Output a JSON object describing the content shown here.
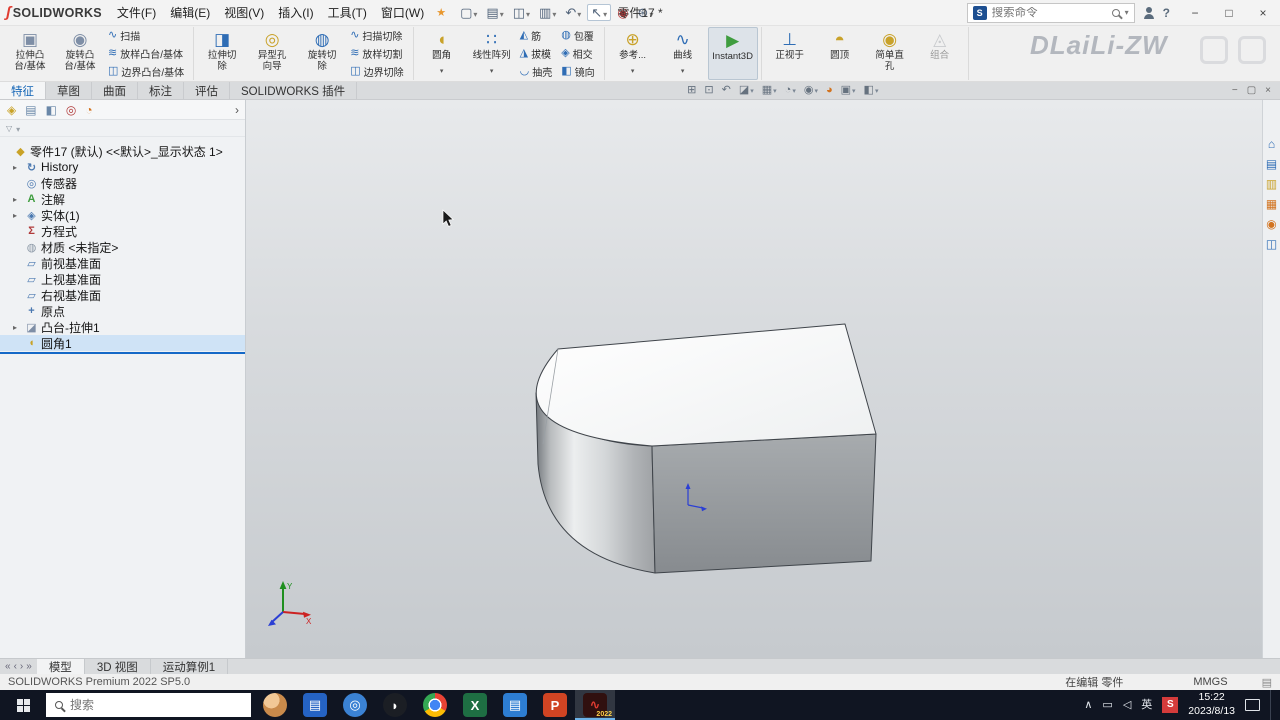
{
  "title_bar": {
    "logo_text": "SOLIDWORKS",
    "logo_mark": "ʃ",
    "menus": [
      "文件(F)",
      "编辑(E)",
      "视图(V)",
      "插入(I)",
      "工具(T)",
      "窗口(W)"
    ],
    "menu_star": "★",
    "document_title": "零件17 *",
    "qat": [
      {
        "name": "new-document-button",
        "glyph": "▢",
        "caret": true
      },
      {
        "name": "open-button",
        "glyph": "▤",
        "caret": true
      },
      {
        "name": "save-button",
        "glyph": "◫",
        "caret": true
      },
      {
        "name": "print-button",
        "glyph": "▥",
        "caret": true
      },
      {
        "name": "undo-button",
        "glyph": "↶",
        "caret": true
      },
      {
        "name": "select-button",
        "glyph": "↖",
        "caret": true,
        "active": true
      },
      {
        "name": "rebuild-button",
        "glyph": "◉",
        "color": "#c43b3b"
      },
      {
        "name": "options-button",
        "glyph": "⊛",
        "caret": true
      }
    ],
    "search": {
      "placeholder": "搜索命令",
      "scope_initial": "S"
    },
    "window_controls": [
      {
        "name": "minimize-button",
        "glyph": "−"
      },
      {
        "name": "maximize-button",
        "glyph": "□"
      },
      {
        "name": "close-button",
        "glyph": "×"
      }
    ]
  },
  "ribbon": {
    "watermark": "DLaiLi-ZW",
    "groups": [
      {
        "cells": [
          {
            "items": [
              {
                "big": true,
                "name": "extruded-boss-button",
                "glyph": "▣",
                "color": "#7e8ea6",
                "label": "拉伸凸\n台/基体"
              }
            ]
          },
          {
            "items": [
              {
                "big": true,
                "name": "revolved-boss-button",
                "glyph": "◉",
                "color": "#7e8ea6",
                "label": "旋转凸\n台/基体"
              }
            ]
          },
          {
            "items": [
              {
                "name": "swept-boss-button",
                "glyph": "∿",
                "color": "#2f6db5",
                "label": "扫描"
              },
              {
                "name": "lofted-boss-button",
                "glyph": "≋",
                "color": "#2f6db5",
                "label": "放样凸台/基体"
              },
              {
                "name": "boundary-boss-button",
                "glyph": "◫",
                "color": "#2f6db5",
                "label": "边界凸台/基体"
              }
            ]
          }
        ]
      },
      {
        "cells": [
          {
            "items": [
              {
                "big": true,
                "name": "extruded-cut-button",
                "glyph": "◨",
                "color": "#2f6db5",
                "label": "拉伸切\n除"
              }
            ]
          },
          {
            "items": [
              {
                "big": true,
                "name": "hole-wizard-button",
                "glyph": "◎",
                "color": "#c9a22a",
                "label": "异型孔\n向导"
              }
            ]
          },
          {
            "items": [
              {
                "big": true,
                "name": "revolved-cut-button",
                "glyph": "◍",
                "color": "#2f6db5",
                "label": "旋转切\n除"
              }
            ]
          },
          {
            "items": [
              {
                "name": "swept-cut-button",
                "glyph": "∿",
                "color": "#2f6db5",
                "label": "扫描切除"
              },
              {
                "name": "lofted-cut-button",
                "glyph": "≋",
                "color": "#2f6db5",
                "label": "放样切割"
              },
              {
                "name": "boundary-cut-button",
                "glyph": "◫",
                "color": "#2f6db5",
                "label": "边界切除"
              }
            ]
          }
        ]
      },
      {
        "cells": [
          {
            "items": [
              {
                "big": true,
                "name": "fillet-button",
                "glyph": "◖",
                "color": "#c9a22a",
                "label": "圆角",
                "caret": true
              }
            ]
          },
          {
            "items": [
              {
                "big": true,
                "name": "linear-pattern-button",
                "glyph": "∷",
                "color": "#2f6db5",
                "label": "线性阵列",
                "caret": true
              }
            ]
          },
          {
            "items": [
              {
                "name": "rib-button",
                "glyph": "◭",
                "color": "#2f6db5",
                "label": "筋"
              },
              {
                "name": "draft-button",
                "glyph": "◮",
                "color": "#2f6db5",
                "label": "拔模"
              },
              {
                "name": "shell-button",
                "glyph": "◡",
                "color": "#2f6db5",
                "label": "抽壳"
              }
            ]
          },
          {
            "items": [
              {
                "name": "wrap-button",
                "glyph": "◍",
                "color": "#2f6db5",
                "label": "包覆"
              },
              {
                "name": "intersect-button",
                "glyph": "◈",
                "color": "#2f6db5",
                "label": "相交"
              },
              {
                "name": "mirror-button",
                "glyph": "◧",
                "color": "#2f6db5",
                "label": "镜向"
              }
            ]
          }
        ]
      },
      {
        "cells": [
          {
            "items": [
              {
                "big": true,
                "name": "reference-geometry-button",
                "glyph": "⊕",
                "color": "#c9a22a",
                "label": "参考...",
                "caret": true
              }
            ]
          },
          {
            "items": [
              {
                "big": true,
                "name": "curves-button",
                "glyph": "∿",
                "color": "#2f6db5",
                "label": "曲线",
                "caret": true
              }
            ]
          },
          {
            "items": [
              {
                "big": true,
                "name": "instant3d-button",
                "glyph": "▶",
                "color": "#3f9d3f",
                "label": "Instant3D",
                "active": true
              }
            ]
          }
        ]
      },
      {
        "cells": [
          {
            "items": [
              {
                "big": true,
                "name": "normal-to-button",
                "glyph": "⊥",
                "color": "#2f6db5",
                "label": "正视于"
              }
            ]
          },
          {
            "items": [
              {
                "big": true,
                "name": "dome-button",
                "glyph": "◓",
                "color": "#c9a22a",
                "label": "圆顶"
              }
            ]
          },
          {
            "items": [
              {
                "big": true,
                "name": "simple-hole-button",
                "glyph": "◉",
                "color": "#c9a22a",
                "label": "简单直\n孔"
              }
            ]
          },
          {
            "items": [
              {
                "big": true,
                "name": "combine-button",
                "glyph": "◬",
                "color": "#9aa0a6",
                "label": "组合",
                "disabled": true
              }
            ]
          }
        ]
      }
    ]
  },
  "command_tabs": [
    {
      "name": "tab-features",
      "label": "特征",
      "active": true
    },
    {
      "name": "tab-sketch",
      "label": "草图"
    },
    {
      "name": "tab-surfaces",
      "label": "曲面"
    },
    {
      "name": "tab-markup",
      "label": "标注"
    },
    {
      "name": "tab-evaluate",
      "label": "评估"
    },
    {
      "name": "tab-addins",
      "label": "SOLIDWORKS 插件"
    }
  ],
  "view_toolbar": [
    {
      "name": "zoom-fit-icon",
      "glyph": "⊞"
    },
    {
      "name": "zoom-area-icon",
      "glyph": "⊡"
    },
    {
      "name": "previous-view-icon",
      "glyph": "↶"
    },
    {
      "name": "section-view-icon",
      "glyph": "◪",
      "caret": true
    },
    {
      "name": "view-orientation-icon",
      "glyph": "▦",
      "caret": true
    },
    {
      "name": "display-style-icon",
      "glyph": "◔",
      "caret": true
    },
    {
      "name": "hide-show-items-icon",
      "glyph": "◉",
      "caret": true
    },
    {
      "name": "edit-appearance-icon",
      "glyph": "◕",
      "color": "#d2731f"
    },
    {
      "name": "apply-scene-icon",
      "glyph": "▣",
      "caret": true
    },
    {
      "name": "view-settings-icon",
      "glyph": "◧",
      "caret": true
    }
  ],
  "doc_window_controls": [
    {
      "name": "doc-minimize-button",
      "glyph": "−"
    },
    {
      "name": "doc-restore-button",
      "glyph": "▢"
    },
    {
      "name": "doc-close-button",
      "glyph": "×"
    }
  ],
  "feature_tree": {
    "panel_tabs": [
      {
        "name": "featuremanager-tab",
        "glyph": "◈",
        "color": "#c9a227"
      },
      {
        "name": "propertymanager-tab",
        "glyph": "▤",
        "color": "#6a87a8"
      },
      {
        "name": "configurationmanager-tab",
        "glyph": "◧",
        "color": "#6a87a8"
      },
      {
        "name": "dimxpert-tab",
        "glyph": "◎",
        "color": "#b03a3a"
      },
      {
        "name": "displaymanager-tab",
        "glyph": "◔",
        "color": "#d2731f"
      }
    ],
    "chevron": "›",
    "items": [
      {
        "name": "tree-root",
        "glyph": "◆",
        "color": "#c9a227",
        "label": "零件17 (默认) <<默认>_显示状态 1>"
      },
      {
        "name": "tree-history",
        "glyph": "↻",
        "color": "#4a78b0",
        "label": "History",
        "arrow": true,
        "child": true
      },
      {
        "name": "tree-sensors",
        "glyph": "◎",
        "color": "#4a78b0",
        "label": "传感器",
        "child": true
      },
      {
        "name": "tree-annotations",
        "glyph": "A",
        "color": "#3f9d3f",
        "label": "注解",
        "arrow": true,
        "child": true
      },
      {
        "name": "tree-solid-bodies",
        "glyph": "◈",
        "color": "#4a78b0",
        "label": "实体(1)",
        "arrow": true,
        "child": true
      },
      {
        "name": "tree-equations",
        "glyph": "Σ",
        "color": "#b03a3a",
        "label": "方程式",
        "child": true
      },
      {
        "name": "tree-material",
        "glyph": "◍",
        "color": "#8a97a5",
        "label": "材质 <未指定>",
        "child": true
      },
      {
        "name": "tree-front-plane",
        "glyph": "▱",
        "color": "#4a78b0",
        "label": "前视基准面",
        "child": true
      },
      {
        "name": "tree-top-plane",
        "glyph": "▱",
        "color": "#4a78b0",
        "label": "上视基准面",
        "child": true
      },
      {
        "name": "tree-right-plane",
        "glyph": "▱",
        "color": "#4a78b0",
        "label": "右视基准面",
        "child": true
      },
      {
        "name": "tree-origin",
        "glyph": "+",
        "color": "#4a78b0",
        "label": "原点",
        "child": true
      },
      {
        "name": "tree-boss-extrude1",
        "glyph": "◪",
        "color": "#7e8ea6",
        "label": "凸台-拉伸1",
        "arrow": true,
        "child": true
      },
      {
        "name": "tree-fillet1",
        "glyph": "◖",
        "color": "#c9a227",
        "label": "圆角1",
        "child": true,
        "selected": true
      }
    ]
  },
  "viewport": {
    "triad": {
      "x_label": "X",
      "y_label": "Y"
    }
  },
  "task_pane": [
    {
      "name": "home-icon",
      "glyph": "⌂",
      "color": "#2f6db5"
    },
    {
      "name": "resources-icon",
      "glyph": "▤",
      "color": "#2f6db5"
    },
    {
      "name": "design-library-icon",
      "glyph": "▥",
      "color": "#c9a22a"
    },
    {
      "name": "file-explorer-icon",
      "glyph": "▦",
      "color": "#d2731f"
    },
    {
      "name": "appearances-icon",
      "glyph": "◉",
      "color": "#d2731f"
    },
    {
      "name": "custom-properties-icon",
      "glyph": "◫",
      "color": "#2f6db5"
    }
  ],
  "bottom_bar": {
    "nav": [
      {
        "name": "rewind-button",
        "glyph": "«"
      },
      {
        "name": "prev-button",
        "glyph": "‹"
      },
      {
        "name": "next-button",
        "glyph": "›"
      },
      {
        "name": "forward-button",
        "glyph": "»"
      }
    ],
    "tabs": [
      {
        "name": "tab-model",
        "label": "模型",
        "active": true
      },
      {
        "name": "tab-3d-views",
        "label": "3D 视图"
      },
      {
        "name": "tab-motion-study",
        "label": "运动算例1"
      }
    ]
  },
  "status_bar": {
    "product": "SOLIDWORKS Premium 2022 SP5.0",
    "editing": "在编辑 零件",
    "units": "MMGS"
  },
  "taskbar": {
    "search_placeholder": "搜索",
    "apps": [
      {
        "name": "taskbar-dog-app",
        "bg": "radial-gradient(circle at 35% 30%, #f2c896 0 35%, #c98a4b 36% 100%)",
        "round": true
      },
      {
        "name": "taskbar-meeting-app",
        "bg": "#2563c4",
        "glyph": "▤",
        "fg": "#ffffff"
      },
      {
        "name": "taskbar-browser-app",
        "bg": "#3b82d4",
        "glyph": "◎",
        "fg": "#ffffff",
        "round": true
      },
      {
        "name": "taskbar-qq-app",
        "bg": "#1b1e24",
        "glyph": "◗",
        "fg": "#ffffff",
        "round": true
      },
      {
        "name": "taskbar-chrome-app",
        "bg": "radial-gradient(circle, #4285f4 0 30%, #ffffff 31% 38%, rgba(0,0,0,0) 39%), conic-gradient(#ea4335 0 33%, #fbbc05 33% 66%, #34a853 66% 100%)",
        "round": true
      },
      {
        "name": "taskbar-excel-app",
        "bg": "#1e6e43",
        "glyph": "X",
        "fg": "#ffffff"
      },
      {
        "name": "taskbar-files-app",
        "bg": "#2d7dd2",
        "glyph": "▤",
        "fg": "#ffffff"
      },
      {
        "name": "taskbar-powerpoint-app",
        "bg": "#d04423",
        "glyph": "P",
        "fg": "#ffffff"
      },
      {
        "name": "taskbar-solidworks-app",
        "bg": "#30100f",
        "glyph": "∿",
        "fg": "#e03c31",
        "active": true,
        "badge": "2022"
      }
    ],
    "tray": {
      "icons": [
        {
          "name": "tray-chevron-icon",
          "glyph": "∧"
        },
        {
          "name": "tray-display-icon",
          "glyph": "▭"
        },
        {
          "name": "tray-volume-icon",
          "glyph": "◁"
        },
        {
          "name": "ime-indicator",
          "glyph": "英"
        },
        {
          "name": "sogou-input-icon",
          "glyph": "S",
          "bg": "#d43b3b",
          "fg": "#ffffff",
          "round": true
        }
      ],
      "time": "15:22",
      "date": "2023/8/13"
    }
  }
}
